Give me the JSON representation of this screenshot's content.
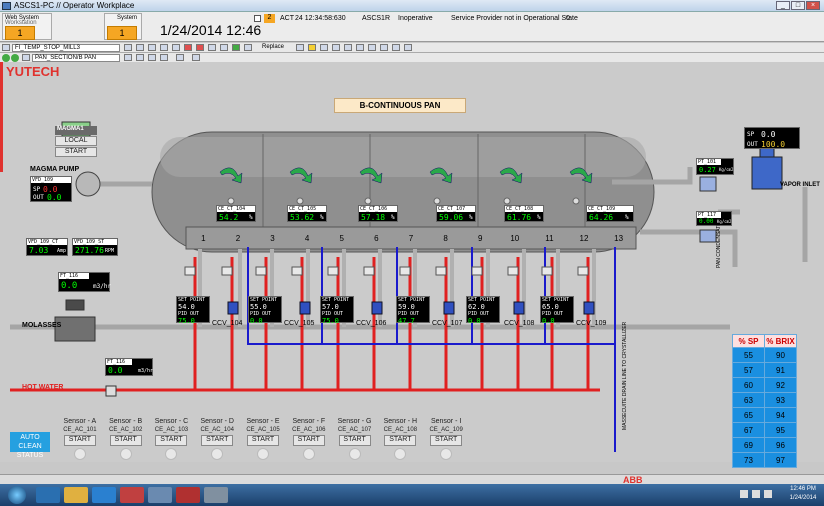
{
  "window": {
    "title": "ASCS1-PC // Operator Workplace"
  },
  "header": {
    "web_system_label": "Web System",
    "web_system_sub": "Workstation",
    "web_system_value": "1",
    "system_label": "System",
    "system_value": "1",
    "datetime": "1/24/2014 12:46",
    "alarm_count": "2",
    "alarm_state": "ACT",
    "alarm_time": "24 12:34:58:630",
    "alarm_source": "ASCS1R",
    "alarm_status": "Inoperative",
    "alarm_text": "Service Provider not in Operational State",
    "alarm_value": "0"
  },
  "toolbar": {
    "select1": "FI_TEMP_STOP_MILL3",
    "select2": "PAN_SECTION/B PAN",
    "replace_label": "Replace"
  },
  "brand": "YUTECH",
  "title": "B-CONTINUOUS PAN",
  "magma": {
    "label": "MAGMA1",
    "local": "LOCAL",
    "start": "START",
    "pump": "MAGMA PUMP"
  },
  "vfd": {
    "name": "VFD_109",
    "sp_label": "SP",
    "sp": "0.0",
    "out_label": "OUT",
    "out": "0.0",
    "ct_name": "VFD_109_CT",
    "ct_value": "7.03",
    "ct_unit": "Amp",
    "st_name": "VFD_109_ST",
    "st_value": "271.76",
    "st_unit": "RPM"
  },
  "ft116": {
    "name": "FT_116",
    "value": "0.0",
    "unit": "m3/hr"
  },
  "ft116b": {
    "name": "FT_116",
    "value": "0.0",
    "unit": "m3/hr"
  },
  "molasses": "MOLASSES",
  "hotwater": "HOT WATER",
  "ce_ct": [
    {
      "name": "CE_CT_104",
      "value": "54.2",
      "unit": "%"
    },
    {
      "name": "CE_CT_105",
      "value": "53.62",
      "unit": "%"
    },
    {
      "name": "CE_CT_106",
      "value": "57.18",
      "unit": "%"
    },
    {
      "name": "CE_CT_107",
      "value": "59.06",
      "unit": "%"
    },
    {
      "name": "CE_CT_108",
      "value": "61.76",
      "unit": "%"
    },
    {
      "name": "CE_CT_109",
      "value": "64.26",
      "unit": "%"
    }
  ],
  "cells": [
    "1",
    "2",
    "3",
    "4",
    "5",
    "6",
    "7",
    "8",
    "9",
    "10",
    "11",
    "12",
    "13"
  ],
  "ccv": [
    {
      "name": "CCV_104",
      "sp_label": "SET POINT",
      "sp": "54.0",
      "pid_label": "PID OUT",
      "pid": "75.0"
    },
    {
      "name": "CCV_105",
      "sp_label": "SET POINT",
      "sp": "55.0",
      "pid_label": "PID OUT",
      "pid": "0.0"
    },
    {
      "name": "CCV_106",
      "sp_label": "SET POINT",
      "sp": "57.0",
      "pid_label": "PID OUT",
      "pid": "75.0"
    },
    {
      "name": "CCV_107",
      "sp_label": "SET POINT",
      "sp": "59.0",
      "pid_label": "PID OUT",
      "pid": "47.7"
    },
    {
      "name": "CCV_108",
      "sp_label": "SET POINT",
      "sp": "62.0",
      "pid_label": "PID OUT",
      "pid": "0.0"
    },
    {
      "name": "CCV_109",
      "sp_label": "SET POINT",
      "sp": "65.0",
      "pid_label": "PID OUT",
      "pid": "0.0"
    }
  ],
  "vapor": {
    "sp_label": "SP",
    "sp": "0.0",
    "out_label": "OUT",
    "out": "100.0",
    "inlet": "VAPOR INLET",
    "pt_name": "PT_101",
    "pt_value": "0.27",
    "pt_unit": "Kg/cm2",
    "pt2_name": "PT_117",
    "pt2_value": "0.00",
    "pt2_unit": "Kg/cm2"
  },
  "condensate": "PAN CONDENSATE",
  "massecuite": "MASSECUITE DRAIN LINE TO CRYSTALLIZER",
  "brix_table": {
    "headers": [
      "% SP",
      "% BRIX"
    ],
    "rows": [
      [
        "55",
        "90"
      ],
      [
        "57",
        "91"
      ],
      [
        "60",
        "92"
      ],
      [
        "63",
        "93"
      ],
      [
        "65",
        "94"
      ],
      [
        "67",
        "95"
      ],
      [
        "69",
        "96"
      ],
      [
        "73",
        "97"
      ]
    ]
  },
  "autoclean": "AUTO CLEAN STATUS",
  "sensors": [
    {
      "name": "Sensor - A",
      "tag": "CE_AC_101",
      "btn": "START"
    },
    {
      "name": "Sensor - B",
      "tag": "CE_AC_102",
      "btn": "START"
    },
    {
      "name": "Sensor - C",
      "tag": "CE_AC_103",
      "btn": "START"
    },
    {
      "name": "Sensor - D",
      "tag": "CE_AC_104",
      "btn": "START"
    },
    {
      "name": "Sensor - E",
      "tag": "CE_AC_105",
      "btn": "START"
    },
    {
      "name": "Sensor - F",
      "tag": "CE_AC_106",
      "btn": "START"
    },
    {
      "name": "Sensor - G",
      "tag": "CE_AC_107",
      "btn": "START"
    },
    {
      "name": "Sensor - H",
      "tag": "CE_AC_108",
      "btn": "START"
    },
    {
      "name": "Sensor - I",
      "tag": "CE_AC_109",
      "btn": "START"
    }
  ],
  "abb": "ABB",
  "clock": {
    "time": "12:46 PM",
    "date": "1/24/2014"
  },
  "colors": {
    "accent": "#f5a623",
    "display_bg": "#000000",
    "display_fg": "#00ff00",
    "brand": "#e0322e",
    "pipe_red": "#e02020",
    "pipe_blue": "#1a1acc"
  }
}
